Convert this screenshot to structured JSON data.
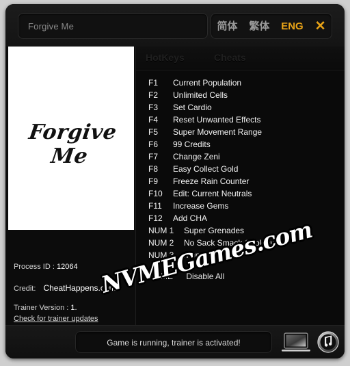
{
  "window": {
    "title": "Forgive Me"
  },
  "search": {
    "value": "Forgive Me",
    "placeholder": "Forgive Me"
  },
  "language": {
    "simplified": "简体",
    "traditional": "繁体",
    "english": "ENG",
    "active": "ENG",
    "close": "✕",
    "accent_color": "#e8a317"
  },
  "cover": {
    "title": "Forgive Me"
  },
  "info": {
    "process_id_label": "Process ID :",
    "process_id_value": "12064",
    "credit_label": "Credit:",
    "credit_value": "CheatHappens.com",
    "trainer_version_label": "Trainer Version :",
    "trainer_version_value": "1.",
    "check_updates": "Check for trainer updates"
  },
  "tabs": [
    {
      "id": "hotkeys",
      "label": "HotKeys",
      "active": true
    },
    {
      "id": "cheats",
      "label": "Cheats",
      "active": false
    }
  ],
  "cheats": [
    {
      "key": "F1",
      "label": "Current Population"
    },
    {
      "key": "F2",
      "label": "Unlimited Cells"
    },
    {
      "key": "F3",
      "label": "Set Cardio"
    },
    {
      "key": "F4",
      "label": "Reset Unwanted Effects"
    },
    {
      "key": "F5",
      "label": "Super Movement Range"
    },
    {
      "key": "F6",
      "label": "99 Credits"
    },
    {
      "key": "F7",
      "label": "Change Zeni"
    },
    {
      "key": "F8",
      "label": "Easy Collect Gold"
    },
    {
      "key": "F9",
      "label": "Freeze Rain Counter"
    },
    {
      "key": "F10",
      "label": "Edit: Current Neutrals"
    },
    {
      "key": "F11",
      "label": "Increase Gems"
    },
    {
      "key": "F12",
      "label": "Add CHA"
    },
    {
      "key": "NUM 1",
      "label": "Super Grenades"
    },
    {
      "key": "NUM 2",
      "label": "No Sack Smack Cooldown"
    },
    {
      "key": "NUM 3",
      "label": "Money Doubler"
    }
  ],
  "home_row": {
    "key": "HOME",
    "label": "Disable All"
  },
  "watermark": {
    "text": "NVMEGames.com"
  },
  "statusbar": {
    "message": "Game is running, trainer is activated!",
    "laptop_icon": "laptop-icon",
    "music_icon": "music-note-icon"
  }
}
